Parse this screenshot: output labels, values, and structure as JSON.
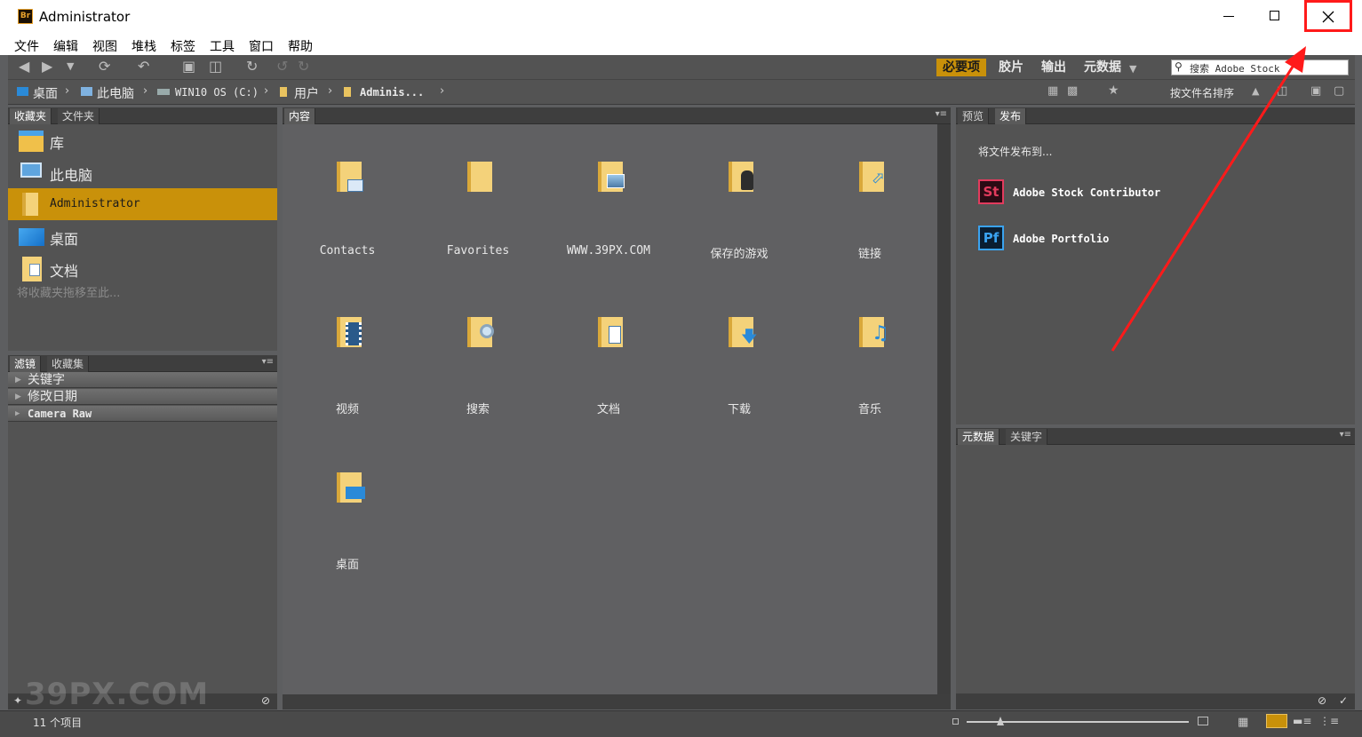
{
  "window": {
    "app_badge": "Br",
    "title": "Administrator"
  },
  "menu": [
    "文件",
    "编辑",
    "视图",
    "堆栈",
    "标签",
    "工具",
    "窗口",
    "帮助"
  ],
  "workspaces": [
    "必要项",
    "胶片",
    "输出",
    "元数据"
  ],
  "search": {
    "placeholder": "搜索 Adobe Stock"
  },
  "breadcrumb": [
    "桌面",
    "此电脑",
    "WIN10 OS (C:)",
    "用户",
    "Adminis..."
  ],
  "sort_label": "按文件名排序",
  "left_panel": {
    "tabs": [
      "收藏夹",
      "文件夹"
    ],
    "items": [
      "库",
      "此电脑",
      "Administrator",
      "桌面",
      "文档"
    ],
    "hint": "将收藏夹拖移至此..."
  },
  "filter_panel": {
    "tabs": [
      "滤镜",
      "收藏集"
    ],
    "rows": [
      "关键字",
      "修改日期",
      "Camera Raw"
    ]
  },
  "content_panel": {
    "tab": "内容",
    "items": [
      "Contacts",
      "Favorites",
      "WWW.39PX.COM",
      "保存的游戏",
      "链接",
      "视频",
      "搜索",
      "文档",
      "下载",
      "音乐",
      "桌面"
    ]
  },
  "publish_panel": {
    "tabs": [
      "预览",
      "发布"
    ],
    "heading": "将文件发布到...",
    "services": [
      {
        "badge": "St",
        "label": "Adobe Stock Contributor",
        "color": "#e23b5d"
      },
      {
        "badge": "Pf",
        "label": "Adobe Portfolio",
        "color": "#3aa3f0"
      }
    ]
  },
  "metadata_panel": {
    "tabs": [
      "元数据",
      "关键字"
    ]
  },
  "status": {
    "count": "11 个项目"
  },
  "watermark": {
    "text": "39PX.COM"
  },
  "colors": {
    "accent": "#c9910a",
    "annotation": "#ff1a1a"
  }
}
